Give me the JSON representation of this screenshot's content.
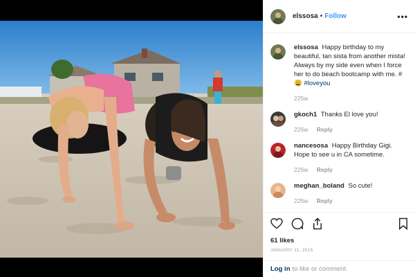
{
  "post": {
    "author": "elssosa",
    "separator": "•",
    "follow_label": "Follow",
    "more_icon": "more-options-icon",
    "photo_description_icon": "beach-photo"
  },
  "comments": [
    {
      "user": "elssosa",
      "text": "Happy birthday to my beautiful, tan sista from another mista! Always by my side even when I force her to do beach bootcamp with me. #😩",
      "tag": "#loveyou",
      "time": "225w",
      "reply": ""
    },
    {
      "user": "gkoch1",
      "text": "Thanks El love you!",
      "tag": "",
      "time": "225w",
      "reply": "Reply"
    },
    {
      "user": "nancesosa",
      "text": "Happy Birthday Gigi. Hope to see u in CA sometime.",
      "tag": "",
      "time": "225w",
      "reply": "Reply"
    },
    {
      "user": "meghan_boland",
      "text": "So cute!",
      "tag": "",
      "time": "225w",
      "reply": "Reply"
    }
  ],
  "footer": {
    "likes": "61 likes",
    "date": "January 11, 2015",
    "login_label": "Log in",
    "login_suffix": "to like or comment."
  },
  "colors": {
    "link_blue": "#3897f0",
    "hashtag": "#003569",
    "muted": "#999999"
  }
}
